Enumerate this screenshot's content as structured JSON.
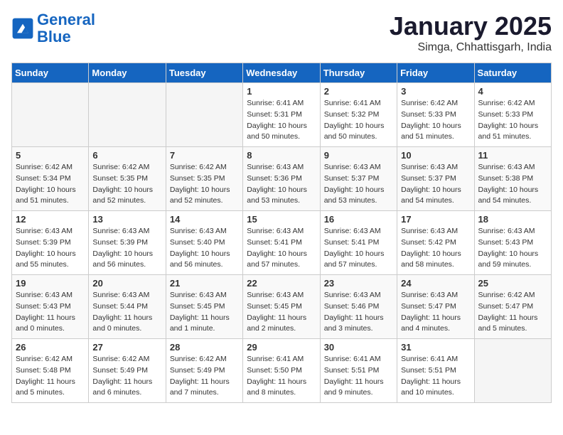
{
  "header": {
    "logo_line1": "General",
    "logo_line2": "Blue",
    "month_title": "January 2025",
    "location": "Simga, Chhattisgarh, India"
  },
  "days_of_week": [
    "Sunday",
    "Monday",
    "Tuesday",
    "Wednesday",
    "Thursday",
    "Friday",
    "Saturday"
  ],
  "weeks": [
    [
      {
        "day": "",
        "info": ""
      },
      {
        "day": "",
        "info": ""
      },
      {
        "day": "",
        "info": ""
      },
      {
        "day": "1",
        "info": "Sunrise: 6:41 AM\nSunset: 5:31 PM\nDaylight: 10 hours\nand 50 minutes."
      },
      {
        "day": "2",
        "info": "Sunrise: 6:41 AM\nSunset: 5:32 PM\nDaylight: 10 hours\nand 50 minutes."
      },
      {
        "day": "3",
        "info": "Sunrise: 6:42 AM\nSunset: 5:33 PM\nDaylight: 10 hours\nand 51 minutes."
      },
      {
        "day": "4",
        "info": "Sunrise: 6:42 AM\nSunset: 5:33 PM\nDaylight: 10 hours\nand 51 minutes."
      }
    ],
    [
      {
        "day": "5",
        "info": "Sunrise: 6:42 AM\nSunset: 5:34 PM\nDaylight: 10 hours\nand 51 minutes."
      },
      {
        "day": "6",
        "info": "Sunrise: 6:42 AM\nSunset: 5:35 PM\nDaylight: 10 hours\nand 52 minutes."
      },
      {
        "day": "7",
        "info": "Sunrise: 6:42 AM\nSunset: 5:35 PM\nDaylight: 10 hours\nand 52 minutes."
      },
      {
        "day": "8",
        "info": "Sunrise: 6:43 AM\nSunset: 5:36 PM\nDaylight: 10 hours\nand 53 minutes."
      },
      {
        "day": "9",
        "info": "Sunrise: 6:43 AM\nSunset: 5:37 PM\nDaylight: 10 hours\nand 53 minutes."
      },
      {
        "day": "10",
        "info": "Sunrise: 6:43 AM\nSunset: 5:37 PM\nDaylight: 10 hours\nand 54 minutes."
      },
      {
        "day": "11",
        "info": "Sunrise: 6:43 AM\nSunset: 5:38 PM\nDaylight: 10 hours\nand 54 minutes."
      }
    ],
    [
      {
        "day": "12",
        "info": "Sunrise: 6:43 AM\nSunset: 5:39 PM\nDaylight: 10 hours\nand 55 minutes."
      },
      {
        "day": "13",
        "info": "Sunrise: 6:43 AM\nSunset: 5:39 PM\nDaylight: 10 hours\nand 56 minutes."
      },
      {
        "day": "14",
        "info": "Sunrise: 6:43 AM\nSunset: 5:40 PM\nDaylight: 10 hours\nand 56 minutes."
      },
      {
        "day": "15",
        "info": "Sunrise: 6:43 AM\nSunset: 5:41 PM\nDaylight: 10 hours\nand 57 minutes."
      },
      {
        "day": "16",
        "info": "Sunrise: 6:43 AM\nSunset: 5:41 PM\nDaylight: 10 hours\nand 57 minutes."
      },
      {
        "day": "17",
        "info": "Sunrise: 6:43 AM\nSunset: 5:42 PM\nDaylight: 10 hours\nand 58 minutes."
      },
      {
        "day": "18",
        "info": "Sunrise: 6:43 AM\nSunset: 5:43 PM\nDaylight: 10 hours\nand 59 minutes."
      }
    ],
    [
      {
        "day": "19",
        "info": "Sunrise: 6:43 AM\nSunset: 5:43 PM\nDaylight: 11 hours\nand 0 minutes."
      },
      {
        "day": "20",
        "info": "Sunrise: 6:43 AM\nSunset: 5:44 PM\nDaylight: 11 hours\nand 0 minutes."
      },
      {
        "day": "21",
        "info": "Sunrise: 6:43 AM\nSunset: 5:45 PM\nDaylight: 11 hours\nand 1 minute."
      },
      {
        "day": "22",
        "info": "Sunrise: 6:43 AM\nSunset: 5:45 PM\nDaylight: 11 hours\nand 2 minutes."
      },
      {
        "day": "23",
        "info": "Sunrise: 6:43 AM\nSunset: 5:46 PM\nDaylight: 11 hours\nand 3 minutes."
      },
      {
        "day": "24",
        "info": "Sunrise: 6:43 AM\nSunset: 5:47 PM\nDaylight: 11 hours\nand 4 minutes."
      },
      {
        "day": "25",
        "info": "Sunrise: 6:42 AM\nSunset: 5:47 PM\nDaylight: 11 hours\nand 5 minutes."
      }
    ],
    [
      {
        "day": "26",
        "info": "Sunrise: 6:42 AM\nSunset: 5:48 PM\nDaylight: 11 hours\nand 5 minutes."
      },
      {
        "day": "27",
        "info": "Sunrise: 6:42 AM\nSunset: 5:49 PM\nDaylight: 11 hours\nand 6 minutes."
      },
      {
        "day": "28",
        "info": "Sunrise: 6:42 AM\nSunset: 5:49 PM\nDaylight: 11 hours\nand 7 minutes."
      },
      {
        "day": "29",
        "info": "Sunrise: 6:41 AM\nSunset: 5:50 PM\nDaylight: 11 hours\nand 8 minutes."
      },
      {
        "day": "30",
        "info": "Sunrise: 6:41 AM\nSunset: 5:51 PM\nDaylight: 11 hours\nand 9 minutes."
      },
      {
        "day": "31",
        "info": "Sunrise: 6:41 AM\nSunset: 5:51 PM\nDaylight: 11 hours\nand 10 minutes."
      },
      {
        "day": "",
        "info": ""
      }
    ]
  ]
}
